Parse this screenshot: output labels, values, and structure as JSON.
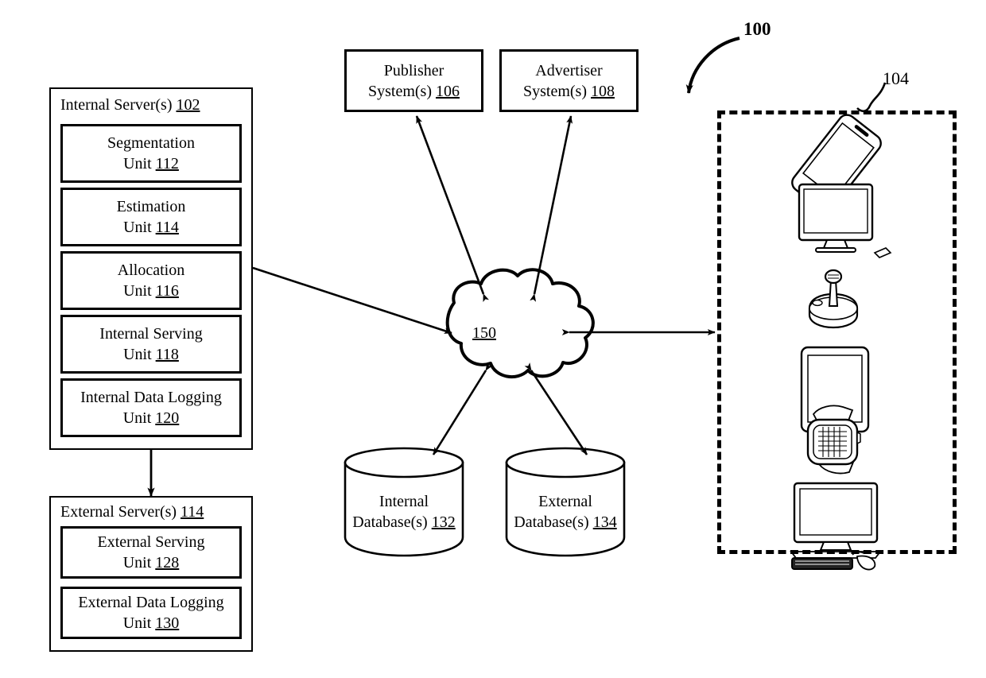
{
  "figure": {
    "ref_main": "100",
    "ref_devices": "104"
  },
  "internal_server_group": {
    "title_text": "Internal Server(s)",
    "title_num": "102",
    "units": [
      {
        "line1": "Segmentation",
        "line2_label": "Unit",
        "line2_num": "112"
      },
      {
        "line1": "Estimation",
        "line2_label": "Unit",
        "line2_num": "114"
      },
      {
        "line1": "Allocation",
        "line2_label": "Unit",
        "line2_num": "116"
      },
      {
        "line1": "Internal Serving",
        "line2_label": "Unit",
        "line2_num": "118"
      },
      {
        "line1": "Internal Data Logging",
        "line2_label": "Unit",
        "line2_num": "120"
      }
    ]
  },
  "external_server_group": {
    "title_text": "External Server(s)",
    "title_num": "114",
    "units": [
      {
        "line1": "External Serving",
        "line2_label": "Unit",
        "line2_num": "128"
      },
      {
        "line1": "External Data Logging",
        "line2_label": "Unit",
        "line2_num": "130"
      }
    ]
  },
  "top_systems": [
    {
      "line1": "Publisher",
      "line2_label": "System(s)",
      "line2_num": "106"
    },
    {
      "line1": "Advertiser",
      "line2_label": "System(s)",
      "line2_num": "108"
    }
  ],
  "network": {
    "label_num": "150"
  },
  "databases": [
    {
      "line1": "Internal",
      "line2_label": "Database(s)",
      "line2_num": "132"
    },
    {
      "line1": "External",
      "line2_label": "Database(s)",
      "line2_num": "134"
    }
  ],
  "devices": [
    {
      "name": "smartphone"
    },
    {
      "name": "monitor-display"
    },
    {
      "name": "joystick-controller"
    },
    {
      "name": "tablet"
    },
    {
      "name": "smartwatch"
    },
    {
      "name": "desktop-computer"
    }
  ],
  "colors": {
    "ink": "#000000",
    "paper": "#ffffff"
  }
}
